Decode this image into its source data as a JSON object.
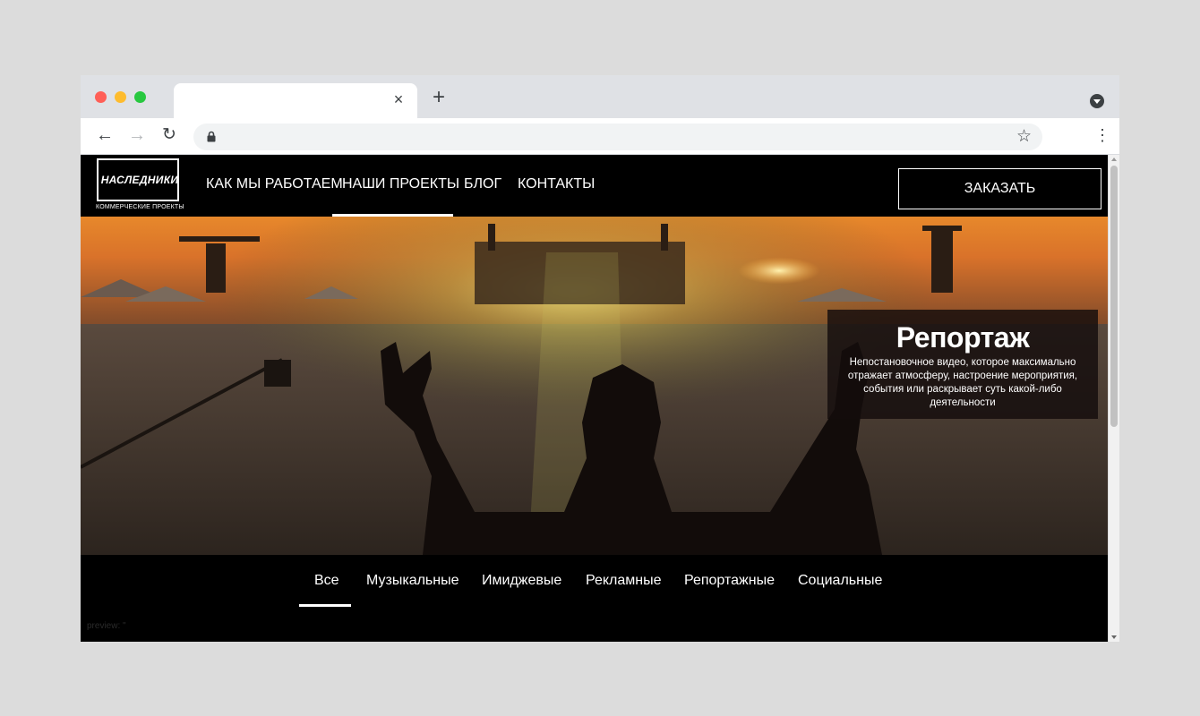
{
  "browser": {
    "tab_title": "",
    "close_glyph": "×",
    "new_tab_glyph": "+",
    "back_glyph": "←",
    "forward_glyph": "→",
    "reload_glyph": "↻",
    "star_glyph": "☆",
    "menu_glyph": "⋮",
    "url": ""
  },
  "site": {
    "logo_text": "НАСЛЕДНИКИ",
    "logo_subtitle": "КОММЕРЧЕСКИЕ ПРОЕКТЫ",
    "nav": [
      {
        "label": "КАК МЫ РАБОТАЕМ"
      },
      {
        "label": "НАШИ ПРОЕКТЫ",
        "active": true
      },
      {
        "label": "БЛОГ"
      },
      {
        "label": "КОНТАКТЫ"
      }
    ],
    "order_button": "ЗАКАЗАТЬ"
  },
  "hero": {
    "title": "Репортаж",
    "description": "Непостановочное видео, которое максимально отражает атмосферу, настроение мероприятия, события или раскрывает суть какой-либо деятельности"
  },
  "filters": [
    {
      "label": "Все",
      "active": true
    },
    {
      "label": "Музыкальные"
    },
    {
      "label": "Имиджевые"
    },
    {
      "label": "Рекламные"
    },
    {
      "label": "Репортажные"
    },
    {
      "label": "Социальные"
    }
  ],
  "preview_text": "preview: \"",
  "colors": {
    "tabstrip": "#dfe1e5",
    "site_background": "#000000",
    "accent_text": "#ffffff"
  }
}
